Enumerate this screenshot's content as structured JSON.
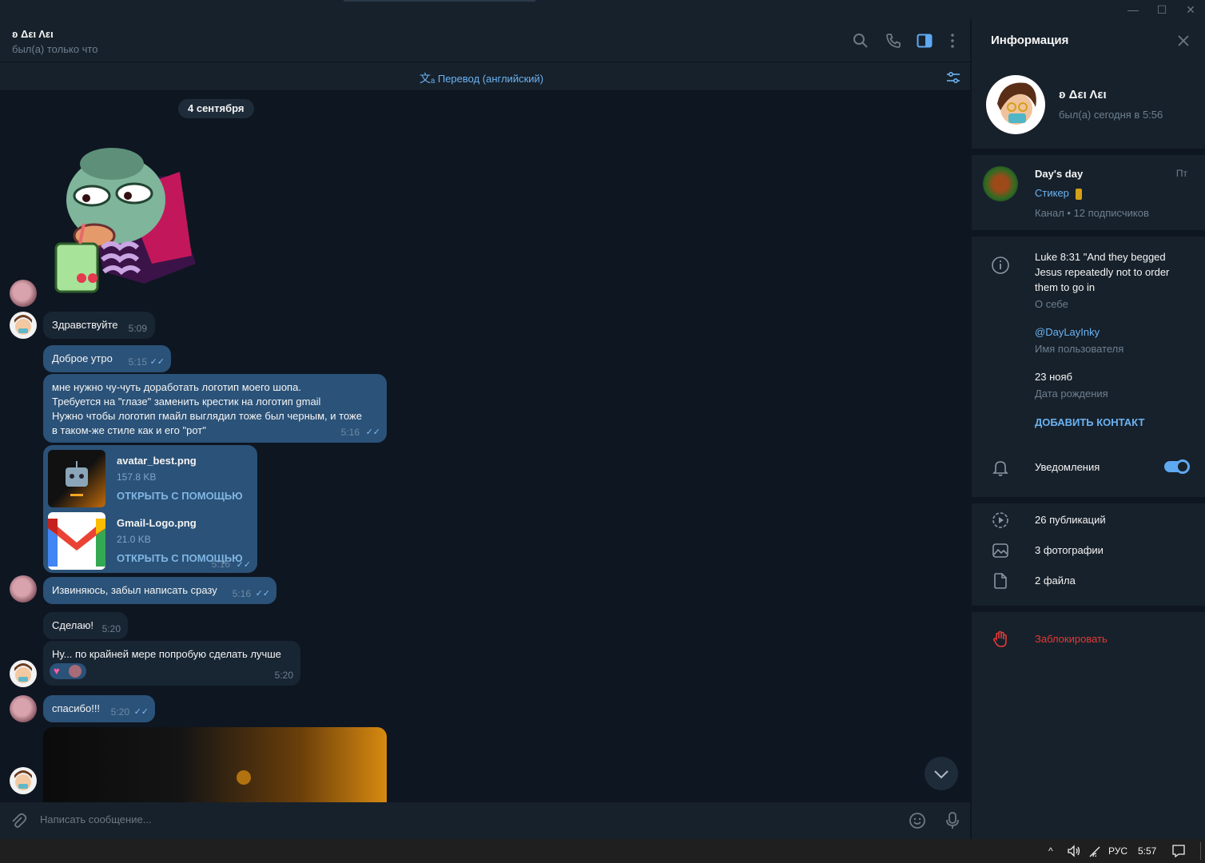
{
  "window": {
    "minimize": "—",
    "maximize": "☐",
    "close": "✕"
  },
  "header": {
    "name": "ʚ Δει Λει",
    "status": "был(а) только что",
    "icons": [
      "search-icon",
      "phone-icon",
      "sidebar-toggle-icon",
      "more-icon"
    ]
  },
  "translate": {
    "label": "Перевод (английский)"
  },
  "chat": {
    "date": "4 сентября",
    "messages": [
      {
        "text": "Здравствуйте",
        "time": "5:09"
      },
      {
        "text": "Доброе утро",
        "time": "5:15"
      },
      {
        "lines": [
          "мне нужно чу-чуть доработать логотип моего шопа.",
          "Требуется на \"глазе\" заменить крестик на логотип gmail",
          "Нужно чтобы логотип гмайл выглядил тоже был черным, и тоже",
          "в таком-же стиле как и его \"рот\""
        ],
        "time": "5:16"
      },
      {
        "text": "Извиняюсь, забыл написать сразу",
        "time": "5:16"
      },
      {
        "text": "Сделаю!",
        "time": "5:20"
      },
      {
        "text": "Ну... по крайней мере попробую сделать лучше",
        "time": "5:20"
      },
      {
        "text": "спасибо!!!",
        "time": "5:20"
      }
    ],
    "files": [
      {
        "name": "avatar_best.png",
        "size": "157.8 KB",
        "action": "ОТКРЫТЬ С ПОМОЩЬЮ"
      },
      {
        "name": "Gmail-Logo.png",
        "size": "21.0 KB",
        "action": "ОТКРЫТЬ С ПОМОЩЬЮ"
      }
    ],
    "files_time": "5:16"
  },
  "composer": {
    "placeholder": "Написать сообщение..."
  },
  "panel": {
    "title": "Информация",
    "name": "ʚ Δει Λει",
    "status": "был(а) сегодня в 5:56",
    "channel": {
      "title": "Day's day",
      "day": "Пт",
      "last": "Стикер",
      "meta": "Канал • 12 подписчиков"
    },
    "bio": [
      "Luke 8:31 \"And they begged",
      "Jesus repeatedly not to order",
      "them to go in"
    ],
    "bio_label": "О себе",
    "username": "@DayLayInky",
    "username_label": "Имя пользователя",
    "birthday": "23 нояб",
    "birthday_label": "Дата рождения",
    "add_contact": "ДОБАВИТЬ КОНТАКТ",
    "notifications": "Уведомления",
    "notifications_on": true,
    "media": {
      "posts": "26 публикаций",
      "photos": "3 фотографии",
      "files": "2 файла"
    },
    "block": "Заблокировать"
  },
  "taskbar": {
    "lang": "РУС",
    "time": "5:57"
  },
  "colors": {
    "accent": "#6ab3f3",
    "outgoing": "#2b5278",
    "incoming": "#182533",
    "danger": "#e53935"
  }
}
